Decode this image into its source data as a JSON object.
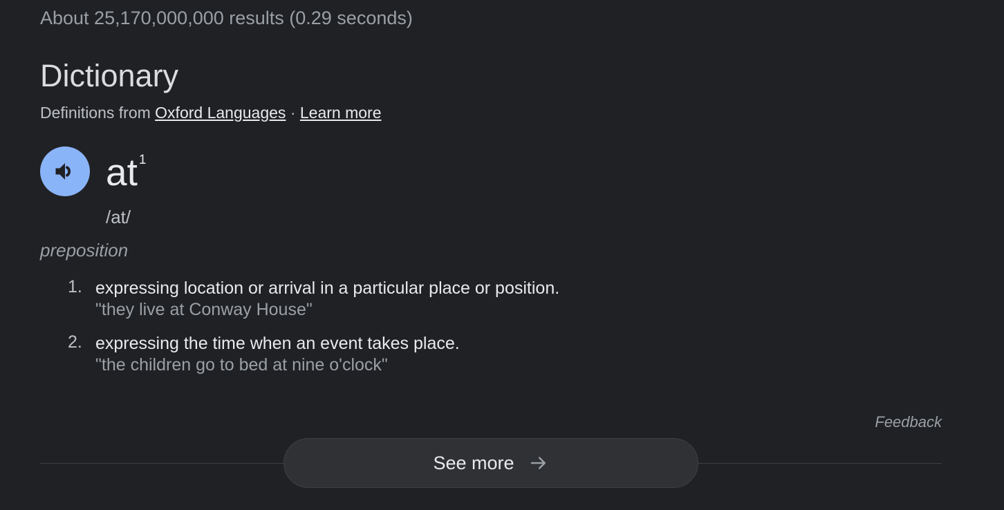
{
  "results": {
    "stats": "About 25,170,000,000 results (0.29 seconds)"
  },
  "dictionary": {
    "heading": "Dictionary",
    "source_prefix": "Definitions from",
    "source_link": "Oxford Languages",
    "separator": "·",
    "learn_more": "Learn more",
    "speaker_icon": "volume-icon",
    "word": "at",
    "word_superscript": "1",
    "phonetic": "/at/",
    "part_of_speech": "preposition",
    "definitions": [
      {
        "number": "1.",
        "text": "expressing location or arrival in a particular place or position.",
        "example": "\"they live at Conway House\""
      },
      {
        "number": "2.",
        "text": "expressing the time when an event takes place.",
        "example": "\"the children go to bed at nine o'clock\""
      }
    ]
  },
  "footer": {
    "feedback": "Feedback",
    "see_more": "See more",
    "see_more_icon": "arrow-right-icon"
  },
  "colors": {
    "background": "#202124",
    "accent": "#8ab4f8",
    "text_primary": "#e8eaed",
    "text_secondary": "#9aa0a6"
  }
}
